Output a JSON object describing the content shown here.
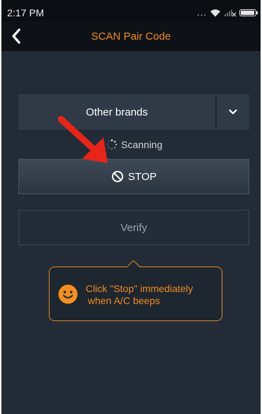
{
  "status_bar": {
    "time": "2:17 PM",
    "dots": "...",
    "icons": [
      "wifi-icon",
      "no-signal-icon",
      "battery-icon"
    ]
  },
  "header": {
    "title": "SCAN Pair Code",
    "back_icon": "chevron-left-icon"
  },
  "brand_select": {
    "value": "Other brands",
    "dropdown_icon": "chevron-down-icon"
  },
  "scanning": {
    "label": "Scanning",
    "icon": "spinner-icon"
  },
  "stop_button": {
    "label": "STOP",
    "icon": "prohibited-icon"
  },
  "verify_button": {
    "label": "Verify"
  },
  "tooltip": {
    "line1": "Click \"Stop\" immediately",
    "line2": "when A/C beeps",
    "icon": "smiley-icon"
  },
  "colors": {
    "accent": "#f08a24",
    "background": "#232c36",
    "arrow": "#e8251b"
  }
}
